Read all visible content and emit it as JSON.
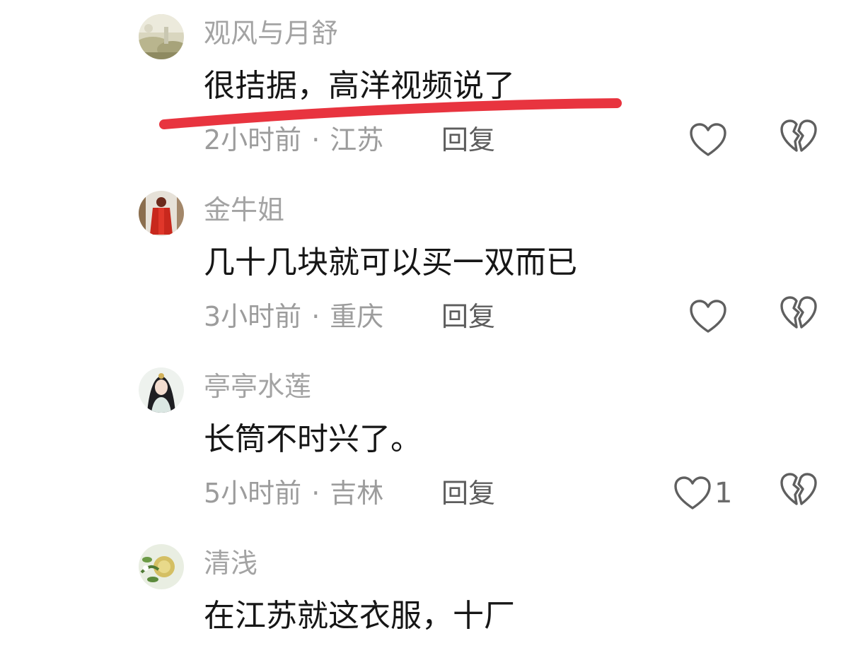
{
  "comments": [
    {
      "username": "观风与月舒",
      "content": "很拮据，高洋视频说了",
      "time": "2小时前",
      "separator": "·",
      "location": "江苏",
      "reply_label": "回复",
      "like_count": "",
      "avatar_icon": "landscape-avatar"
    },
    {
      "username": "金牛姐",
      "content": "几十几块就可以买一双而已",
      "time": "3小时前",
      "separator": "·",
      "location": "重庆",
      "reply_label": "回复",
      "like_count": "",
      "avatar_icon": "red-figure-avatar"
    },
    {
      "username": "亭亭水莲",
      "content": "长筒不时兴了。",
      "time": "5小时前",
      "separator": "·",
      "location": "吉林",
      "reply_label": "回复",
      "like_count": "1",
      "avatar_icon": "portrait-avatar"
    },
    {
      "username": "清浅",
      "content": "在江苏就这衣服，十厂",
      "avatar_icon": "flower-avatar"
    }
  ],
  "colors": {
    "highlight_underline": "#e8343f",
    "username": "#a3a3a3",
    "content": "#161616",
    "meta": "#9c9c9c",
    "icon_stroke": "#5f5f5f"
  },
  "icons": {
    "like": "heart-outline-icon",
    "dislike": "broken-heart-icon"
  }
}
